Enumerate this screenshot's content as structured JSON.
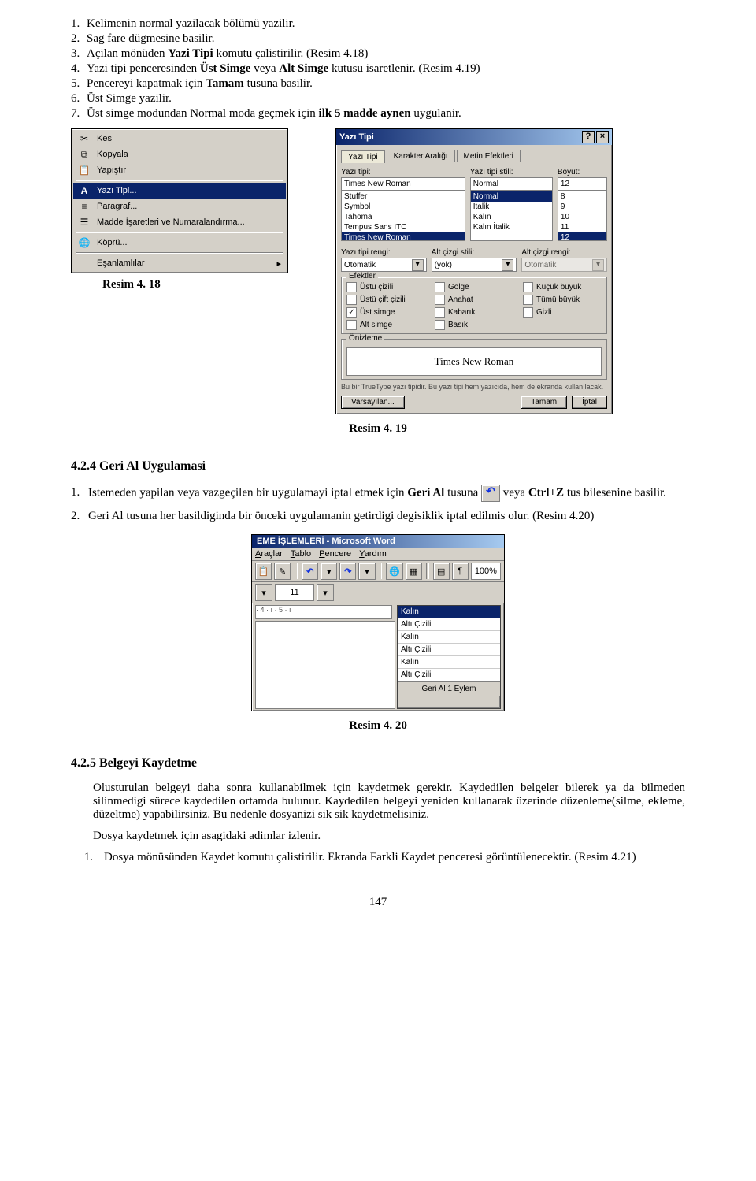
{
  "instructions": {
    "i1": "Kelimenin normal yazilacak bölümü yazilir.",
    "i2": "Sag fare dügmesine basilir.",
    "i3a": "Açilan mönüden ",
    "i3b": "Yazi Tipi",
    "i3c": " komutu çalistirilir. (Resim 4.18)",
    "i4a": "Yazi tipi penceresinden ",
    "i4b": "Üst Simge",
    "i4c": " veya ",
    "i4d": "Alt Simge",
    "i4e": " kutusu isaretlenir. (Resim 4.19)",
    "i5a": "Pencereyi kapatmak için ",
    "i5b": "Tamam",
    "i5c": " tusuna basilir.",
    "i6": "Üst Simge yazilir.",
    "i7a": "Üst simge modundan Normal moda geçmek için ",
    "i7b": "ilk 5 madde aynen",
    "i7c": " uygulanir."
  },
  "context_menu": {
    "kes": "Kes",
    "kopyala": "Kopyala",
    "yapistir": "Yapıştır",
    "yazitipi": "Yazı Tipi...",
    "paragraf": "Paragraf...",
    "madde": "Madde İşaretleri ve Numaralandırma...",
    "kopru": "Köprü...",
    "esanlam": "Eşanlamlılar"
  },
  "captions": {
    "r418": "Resim 4. 18",
    "r419": "Resim 4. 19",
    "r420": "Resim 4. 20"
  },
  "dialog": {
    "title": "Yazı Tipi",
    "tab1": "Yazı Tipi",
    "tab2": "Karakter Aralığı",
    "tab3": "Metin Efektleri",
    "lbl_font": "Yazı tipi:",
    "lbl_style": "Yazı tipi stili:",
    "lbl_size": "Boyut:",
    "font_val": "Times New Roman",
    "font_list": [
      "Stuffer",
      "Symbol",
      "Tahoma",
      "Tempus Sans ITC",
      "Times New Roman"
    ],
    "style_val": "Normal",
    "style_list": [
      "Normal",
      "İtalik",
      "Kalın",
      "Kalın İtalik"
    ],
    "size_val": "12",
    "size_list": [
      "8",
      "9",
      "10",
      "11",
      "12"
    ],
    "lbl_color": "Yazı tipi rengi:",
    "lbl_uline": "Alt çizgi stili:",
    "lbl_ucol": "Alt çizgi rengi:",
    "color_val": "Otomatik",
    "uline_val": "(yok)",
    "ucol_val": "Otomatik",
    "grp_eff": "Efektler",
    "effects_col1": [
      "Üstü çizili",
      "Üstü çift çizili",
      "Üst simge",
      "Alt simge"
    ],
    "effects_col2": [
      "Gölge",
      "Anahat",
      "Kabarık",
      "Basık"
    ],
    "effects_col3": [
      "Küçük büyük",
      "Tümü büyük",
      "Gizli"
    ],
    "eff_checked": "Üst simge",
    "grp_prev": "Önizleme",
    "preview_sample": "Times New Roman",
    "note_line": "Bu bir TrueType yazı tipidir. Bu yazı tipi hem yazıcıda, hem de ekranda kullanılacak.",
    "btn_default": "Varsayılan...",
    "btn_ok": "Tamam",
    "btn_cancel": "İptal"
  },
  "section_424": {
    "heading": "4.2.4 Geri Al Uygulamasi",
    "p1a": "Istemeden yapilan veya  vazgeçilen bir uygulamayi iptal etmek için ",
    "p1b": "Geri Al",
    "p1c": " tusuna ",
    "p1d": " veya ",
    "p1e": "Ctrl+Z",
    "p1f": " tus bilesenine basilir.",
    "p2a": "Geri Al tusuna her basildiginda bir önceki uygulamanin getirdigi degisiklik iptal edilmis olur. (Resim 4.20)"
  },
  "wordwin": {
    "title": "EME İŞLEMLERİ - Microsoft Word",
    "menus": [
      "Araçlar",
      "Tablo",
      "Pencere",
      "Yardım"
    ],
    "zoom": "100%",
    "fsize": "11",
    "undo_items": [
      "Kalın",
      "Altı Çizili",
      "Kalın",
      "Altı Çizili",
      "Kalın",
      "Altı Çizili"
    ],
    "undo_cap": "Geri Al 1 Eylem"
  },
  "section_425": {
    "heading": "4.2.5  Belgeyi Kaydetme",
    "p1": "Olusturulan belgeyi daha sonra kullanabilmek için kaydetmek gerekir. Kaydedilen belgeler bilerek ya da bilmeden silinmedigi sürece kaydedilen ortamda bulunur. Kaydedilen belgeyi yeniden kullanarak üzerinde düzenleme(silme, ekleme, düzeltme) yapabilirsiniz. Bu nedenle dosyanizi sik sik kaydetmelisiniz.",
    "p2": "Dosya kaydetmek için asagidaki adimlar izlenir.",
    "p3a": "Dosya mönüsünden Kaydet komutu çalistirilir. Ekranda Farkli Kaydet penceresi görüntülenecektir. (Resim 4.21)"
  },
  "page_number": "147"
}
